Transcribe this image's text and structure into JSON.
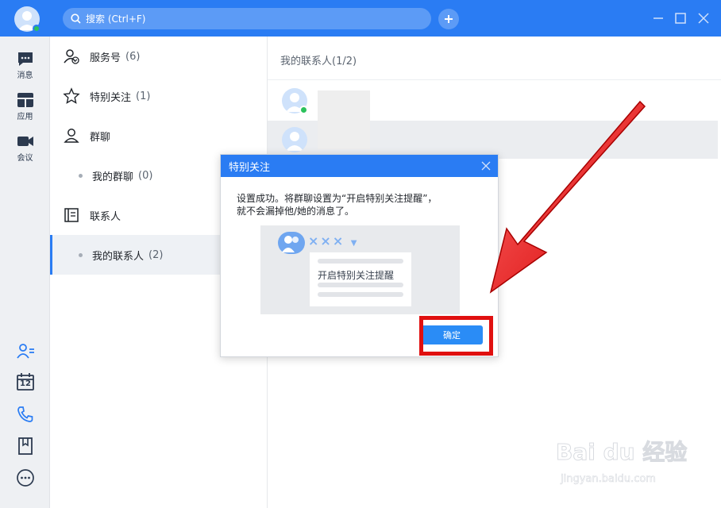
{
  "titlebar": {
    "search_placeholder": "搜索 (Ctrl+F)",
    "accent": "#2a7cf3"
  },
  "rail": {
    "items": [
      {
        "label": "消息",
        "icon": "message-icon"
      },
      {
        "label": "应用",
        "icon": "apps-icon"
      },
      {
        "label": "会议",
        "icon": "video-icon"
      }
    ],
    "bottom_icons": [
      "add-contact-icon",
      "calendar-icon",
      "phone-icon",
      "bookmark-icon",
      "more-icon"
    ],
    "calendar_day": "12"
  },
  "categories": [
    {
      "label": "服务号",
      "count": "(6)",
      "icon": "service-icon"
    },
    {
      "label": "特别关注",
      "count": "(1)",
      "icon": "star-icon"
    },
    {
      "label": "群聊",
      "count": "",
      "icon": "group-icon"
    },
    {
      "label": "我的群聊",
      "count": "(0)",
      "sub": true
    },
    {
      "label": "联系人",
      "count": "",
      "icon": "contacts-icon"
    },
    {
      "label": "我的联系人",
      "count": "(2)",
      "sub": true,
      "active": true
    }
  ],
  "panel": {
    "title": "我的联系人(1/2)"
  },
  "dialog": {
    "title": "特别关注",
    "message_line1": "设置成功。将群聊设置为“开启特别关注提醒”，",
    "message_line2": "就不会漏掉他/她的消息了。",
    "illus_name": "×××",
    "illus_text": "开启特别关注提醒",
    "ok_label": "确定"
  },
  "watermark": {
    "brand": "Bai du 经验",
    "url": "jingyan.baidu.com"
  }
}
